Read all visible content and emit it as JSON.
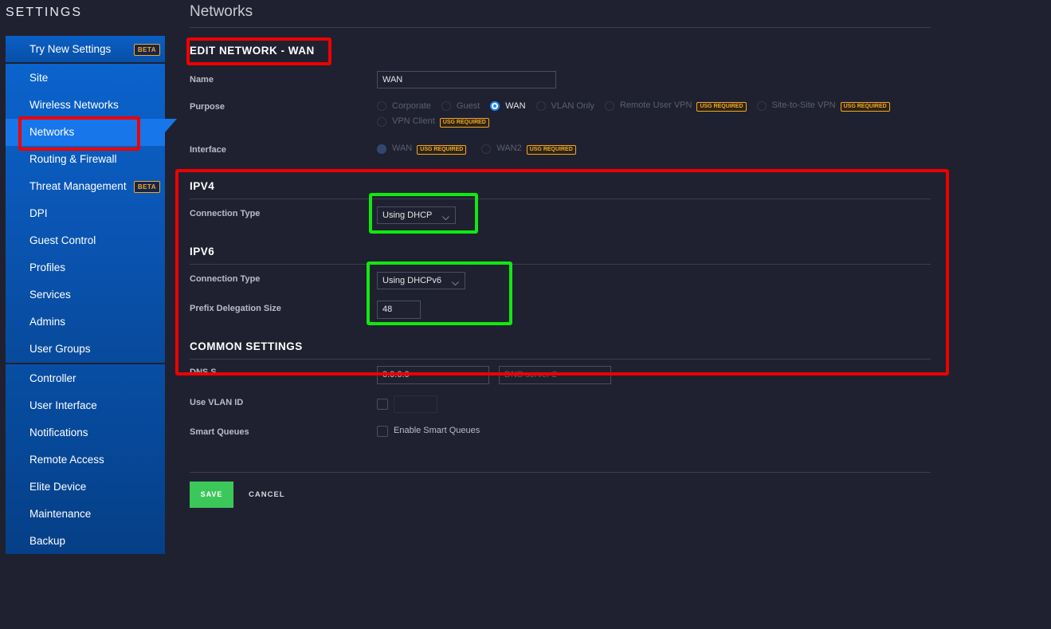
{
  "settings_title": "SETTINGS",
  "sidebar": {
    "group1": [
      {
        "label": "Try New Settings",
        "badge": "BETA"
      }
    ],
    "group2": [
      {
        "label": "Site"
      },
      {
        "label": "Wireless Networks"
      },
      {
        "label": "Networks"
      },
      {
        "label": "Routing & Firewall"
      },
      {
        "label": "Threat Management",
        "badge": "BETA"
      },
      {
        "label": "DPI"
      },
      {
        "label": "Guest Control"
      },
      {
        "label": "Profiles"
      },
      {
        "label": "Services"
      },
      {
        "label": "Admins"
      },
      {
        "label": "User Groups"
      }
    ],
    "group3": [
      {
        "label": "Controller"
      },
      {
        "label": "User Interface"
      },
      {
        "label": "Notifications"
      },
      {
        "label": "Remote Access"
      },
      {
        "label": "Elite Device"
      },
      {
        "label": "Maintenance"
      },
      {
        "label": "Backup"
      }
    ],
    "active": "Networks"
  },
  "page_title": "Networks",
  "edit_title": "EDIT NETWORK - WAN",
  "form": {
    "name_label": "Name",
    "name_value": "WAN",
    "purpose_label": "Purpose",
    "purpose_options": [
      {
        "label": "Corporate"
      },
      {
        "label": "Guest"
      },
      {
        "label": "WAN",
        "selected": true
      },
      {
        "label": "VLAN Only"
      },
      {
        "label": "Remote User VPN",
        "badge": "USG REQUIRED"
      },
      {
        "label": "Site-to-Site VPN",
        "badge": "USG REQUIRED"
      },
      {
        "label": "VPN Client",
        "badge": "USG REQUIRED"
      }
    ],
    "interface_label": "Interface",
    "interface_options": [
      {
        "label": "WAN",
        "badge": "USG REQUIRED",
        "selected": true
      },
      {
        "label": "WAN2",
        "badge": "USG REQUIRED"
      }
    ]
  },
  "ipv4": {
    "title": "IPV4",
    "connection_type_label": "Connection Type",
    "connection_type_value": "Using DHCP"
  },
  "ipv6": {
    "title": "IPV6",
    "connection_type_label": "Connection Type",
    "connection_type_value": "Using DHCPv6",
    "prefix_label": "Prefix Delegation Size",
    "prefix_value": "48"
  },
  "common": {
    "title": "COMMON SETTINGS",
    "dns_label": "DNS S",
    "dns1_value": "0.0.0.0",
    "dns2_placeholder": "DNS server 2",
    "vlan_label": "Use VLAN ID",
    "smart_queues_label": "Smart Queues",
    "smart_queues_checkbox_label": "Enable Smart Queues"
  },
  "actions": {
    "save": "SAVE",
    "cancel": "CANCEL"
  },
  "colors": {
    "background": "#1f2130",
    "sidebar_blue": "#0a5fc4",
    "active_blue": "#1777ea",
    "save_green": "#3cc75a",
    "badge_orange": "#f5a623",
    "annotation_red": "#ee0000",
    "annotation_green": "#11e811"
  }
}
